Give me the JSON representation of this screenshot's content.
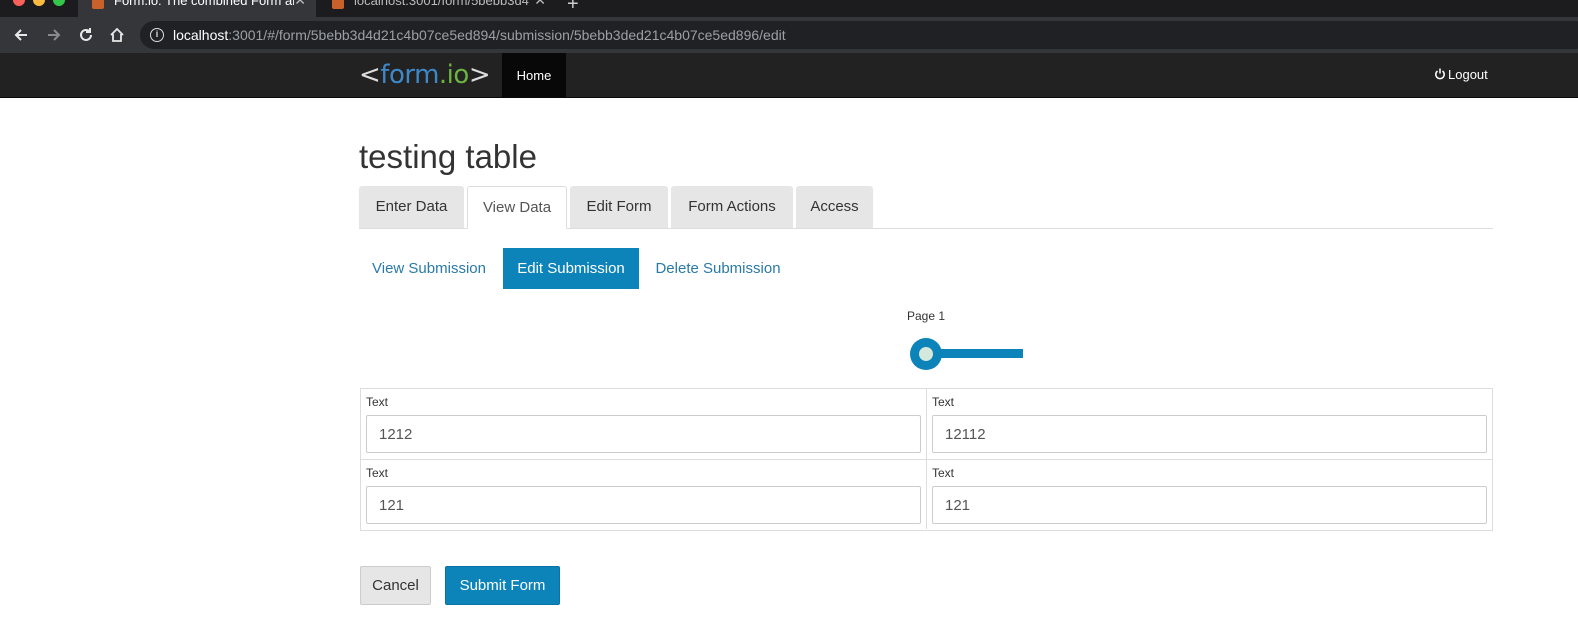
{
  "browser": {
    "tabs": [
      {
        "title": "Form.io: The combined Form and",
        "active": true
      },
      {
        "title": "localhost:3001/form/5bebb3d4",
        "active": false
      }
    ],
    "url_host": "localhost",
    "url_path": ":3001/#/form/5bebb3d4d21c4b07ce5ed894/submission/5bebb3ded21c4b07ce5ed896/edit"
  },
  "nav": {
    "logo": {
      "left": "<",
      "form": "form",
      "io": ".io",
      "right": ">"
    },
    "home_label": "Home",
    "logout_label": "Logout"
  },
  "page": {
    "title": "testing table",
    "form_tabs": [
      {
        "label": "Enter Data"
      },
      {
        "label": "View Data"
      },
      {
        "label": "Edit Form"
      },
      {
        "label": "Form Actions"
      },
      {
        "label": "Access"
      }
    ],
    "submission_actions": [
      {
        "label": "View Submission"
      },
      {
        "label": "Edit Submission"
      },
      {
        "label": "Delete Submission"
      }
    ],
    "wizard": {
      "page_label": "Page 1"
    },
    "table": [
      [
        {
          "label": "Text",
          "value": "1212"
        },
        {
          "label": "Text",
          "value": "12112"
        }
      ],
      [
        {
          "label": "Text",
          "value": "121"
        },
        {
          "label": "Text",
          "value": "121"
        }
      ]
    ],
    "buttons": {
      "cancel": "Cancel",
      "submit": "Submit Form"
    }
  },
  "colors": {
    "primary": "#0c83b9",
    "navbar": "#222222",
    "tab_inactive": "#e6e6e6"
  }
}
